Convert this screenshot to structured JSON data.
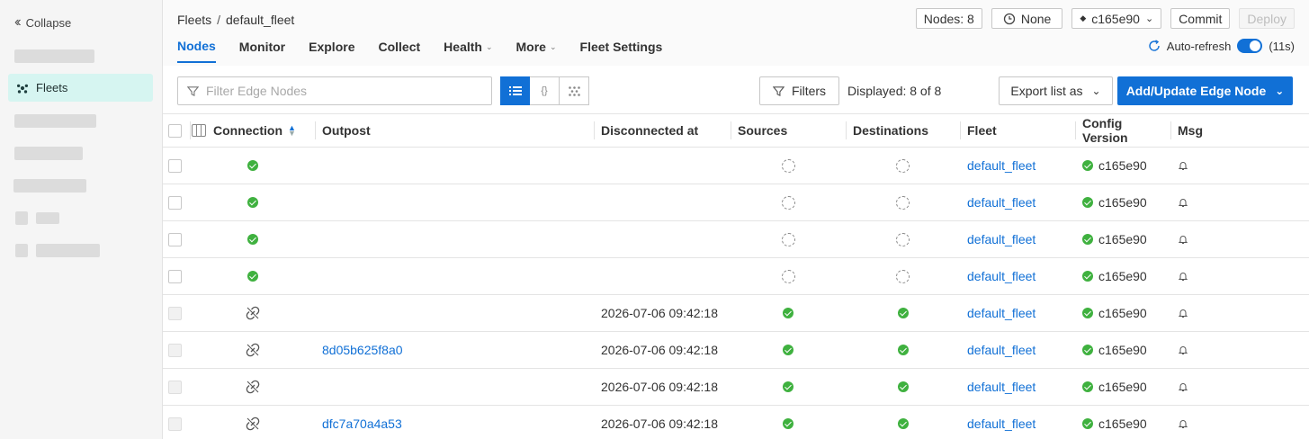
{
  "sidebar": {
    "collapse_label": "Collapse",
    "active_item": "Fleets"
  },
  "breadcrumb": {
    "parent": "Fleets",
    "separator": "/",
    "current": "default_fleet"
  },
  "tabs": [
    {
      "label": "Nodes",
      "active": true,
      "dropdown": false
    },
    {
      "label": "Monitor",
      "dropdown": false
    },
    {
      "label": "Explore",
      "dropdown": false
    },
    {
      "label": "Collect",
      "dropdown": false
    },
    {
      "label": "Health",
      "dropdown": true
    },
    {
      "label": "More",
      "dropdown": true
    },
    {
      "label": "Fleet Settings",
      "dropdown": false
    }
  ],
  "top_actions": {
    "nodes": "Nodes: 8",
    "none": "None",
    "commit_hash": "c165e90",
    "commit": "Commit",
    "deploy": "Deploy"
  },
  "auto_refresh": {
    "label": "Auto-refresh",
    "interval": "(11s)",
    "enabled": true
  },
  "toolbar": {
    "filter_placeholder": "Filter Edge Nodes",
    "view_json": "{}",
    "filters": "Filters",
    "displayed": "Displayed: 8 of 8",
    "export": "Export list as",
    "add": "Add/Update Edge Node"
  },
  "columns": {
    "connection": "Connection",
    "outpost": "Outpost",
    "disconnected": "Disconnected at",
    "sources": "Sources",
    "destinations": "Destinations",
    "fleet": "Fleet",
    "config": "Config Version",
    "msg": "Msg"
  },
  "rows": [
    {
      "connected": true,
      "outpost": "",
      "disconnected": "",
      "sources": "pending",
      "destinations": "pending",
      "fleet": "default_fleet",
      "config": "c165e90"
    },
    {
      "connected": true,
      "outpost": "",
      "disconnected": "",
      "sources": "pending",
      "destinations": "pending",
      "fleet": "default_fleet",
      "config": "c165e90"
    },
    {
      "connected": true,
      "outpost": "",
      "disconnected": "",
      "sources": "pending",
      "destinations": "pending",
      "fleet": "default_fleet",
      "config": "c165e90"
    },
    {
      "connected": true,
      "outpost": "",
      "disconnected": "",
      "sources": "pending",
      "destinations": "pending",
      "fleet": "default_fleet",
      "config": "c165e90"
    },
    {
      "connected": false,
      "outpost": "",
      "disconnected": "2026-07-06 09:42:18",
      "sources": "ok",
      "destinations": "ok",
      "fleet": "default_fleet",
      "config": "c165e90"
    },
    {
      "connected": false,
      "outpost": "8d05b625f8a0",
      "disconnected": "2026-07-06 09:42:18",
      "sources": "ok",
      "destinations": "ok",
      "fleet": "default_fleet",
      "config": "c165e90"
    },
    {
      "connected": false,
      "outpost": "",
      "disconnected": "2026-07-06 09:42:18",
      "sources": "ok",
      "destinations": "ok",
      "fleet": "default_fleet",
      "config": "c165e90"
    },
    {
      "connected": false,
      "outpost": "dfc7a70a4a53",
      "disconnected": "2026-07-06 09:42:18",
      "sources": "ok",
      "destinations": "ok",
      "fleet": "default_fleet",
      "config": "c165e90"
    }
  ],
  "colors": {
    "accent": "#1170d6",
    "ok": "#3fb13f",
    "active_nav": "#d6f5f1"
  }
}
